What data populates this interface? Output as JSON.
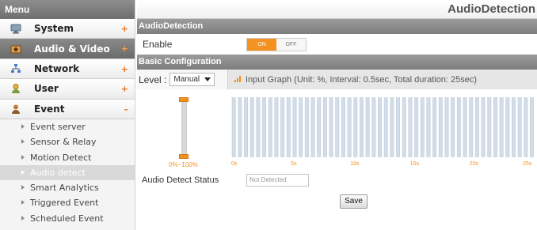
{
  "menu": {
    "title": "Menu",
    "items": [
      {
        "label": "System",
        "icon": "system-icon",
        "sign": "+",
        "active": false
      },
      {
        "label": "Audio & Video",
        "icon": "audio-video-icon",
        "sign": "+",
        "active": true
      },
      {
        "label": "Network",
        "icon": "network-icon",
        "sign": "+",
        "active": false
      },
      {
        "label": "User",
        "icon": "user-icon",
        "sign": "+",
        "active": false
      },
      {
        "label": "Event",
        "icon": "event-icon",
        "sign": "–",
        "active": false
      }
    ],
    "event_subitems": [
      {
        "label": "Event server",
        "active": false
      },
      {
        "label": "Sensor & Relay",
        "active": false
      },
      {
        "label": "Motion Detect",
        "active": false
      },
      {
        "label": "Audio detect",
        "active": true
      },
      {
        "label": "Smart Analytics",
        "active": false
      },
      {
        "label": "Triggered Event",
        "active": false
      },
      {
        "label": "Scheduled Event",
        "active": false
      }
    ]
  },
  "page": {
    "title": "AudioDetection",
    "section1": "AudioDetection",
    "enable_label": "Enable",
    "toggle_on": "ON",
    "toggle_off": "OFF",
    "enabled": true,
    "section2": "Basic Configuration",
    "level_label": "Level :",
    "level_value": "Manual",
    "graph_info": "Input Graph (Unit: %, Interval: 0.5sec, Total duration: 25sec)",
    "range_label": "0%~100%",
    "threshold_range_percent": [
      0,
      100
    ],
    "x_labels": [
      "0s",
      "5s",
      "10s",
      "15s",
      "20s",
      "25s"
    ],
    "bar_count": 50,
    "status_label": "Audio Detect Status",
    "status_value": "Not Detected",
    "save_label": "Save"
  },
  "colors": {
    "accent": "#f39220",
    "bar_fill": "#d3dde8",
    "bar_stroke": "#b9c7d6"
  }
}
